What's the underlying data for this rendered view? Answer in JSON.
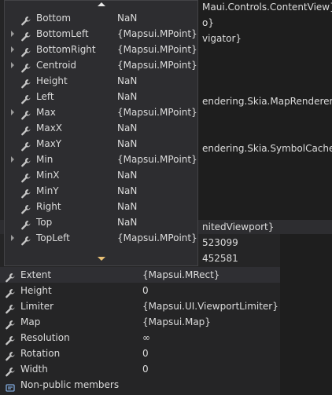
{
  "background_watch": {
    "lines": [
      "Maui.Controls.ContentView}",
      "o}",
      "vigator}",
      "endering.Skia.MapRenderer}",
      "endering.Skia.SymbolCache}"
    ],
    "scroll_row_text": "nitedViewport}",
    "num1": "523099",
    "num2": "452581"
  },
  "popup": {
    "rows": [
      {
        "name": "Bottom",
        "value": "NaN",
        "expandable": false
      },
      {
        "name": "BottomLeft",
        "value": "{Mapsui.MPoint}",
        "expandable": true
      },
      {
        "name": "BottomRight",
        "value": "{Mapsui.MPoint}",
        "expandable": true
      },
      {
        "name": "Centroid",
        "value": "{Mapsui.MPoint}",
        "expandable": true
      },
      {
        "name": "Height",
        "value": "NaN",
        "expandable": false
      },
      {
        "name": "Left",
        "value": "NaN",
        "expandable": false
      },
      {
        "name": "Max",
        "value": "{Mapsui.MPoint}",
        "expandable": true
      },
      {
        "name": "MaxX",
        "value": "NaN",
        "expandable": false
      },
      {
        "name": "MaxY",
        "value": "NaN",
        "expandable": false
      },
      {
        "name": "Min",
        "value": "{Mapsui.MPoint}",
        "expandable": true
      },
      {
        "name": "MinX",
        "value": "NaN",
        "expandable": false
      },
      {
        "name": "MinY",
        "value": "NaN",
        "expandable": false
      },
      {
        "name": "Right",
        "value": "NaN",
        "expandable": false
      },
      {
        "name": "Top",
        "value": "NaN",
        "expandable": false
      },
      {
        "name": "TopLeft",
        "value": "{Mapsui.MPoint}",
        "expandable": true
      }
    ]
  },
  "bottom": {
    "rows": [
      {
        "name": "Extent",
        "value": "{Mapsui.MRect}",
        "icon": "wrench-icon"
      },
      {
        "name": "Height",
        "value": "0",
        "icon": "wrench-icon"
      },
      {
        "name": "Limiter",
        "value": "{Mapsui.UI.ViewportLimiter}",
        "icon": "wrench-icon"
      },
      {
        "name": "Map",
        "value": "{Mapsui.Map}",
        "icon": "wrench-icon"
      },
      {
        "name": "Resolution",
        "value": "∞",
        "icon": "wrench-icon"
      },
      {
        "name": "Rotation",
        "value": "0",
        "icon": "wrench-icon"
      },
      {
        "name": "Width",
        "value": "0",
        "icon": "wrench-icon"
      },
      {
        "name": "Non-public members",
        "value": "",
        "icon": "members-icon"
      }
    ]
  },
  "colors": {
    "accent": "#e8c074",
    "wrench": "#c8c8c8"
  }
}
